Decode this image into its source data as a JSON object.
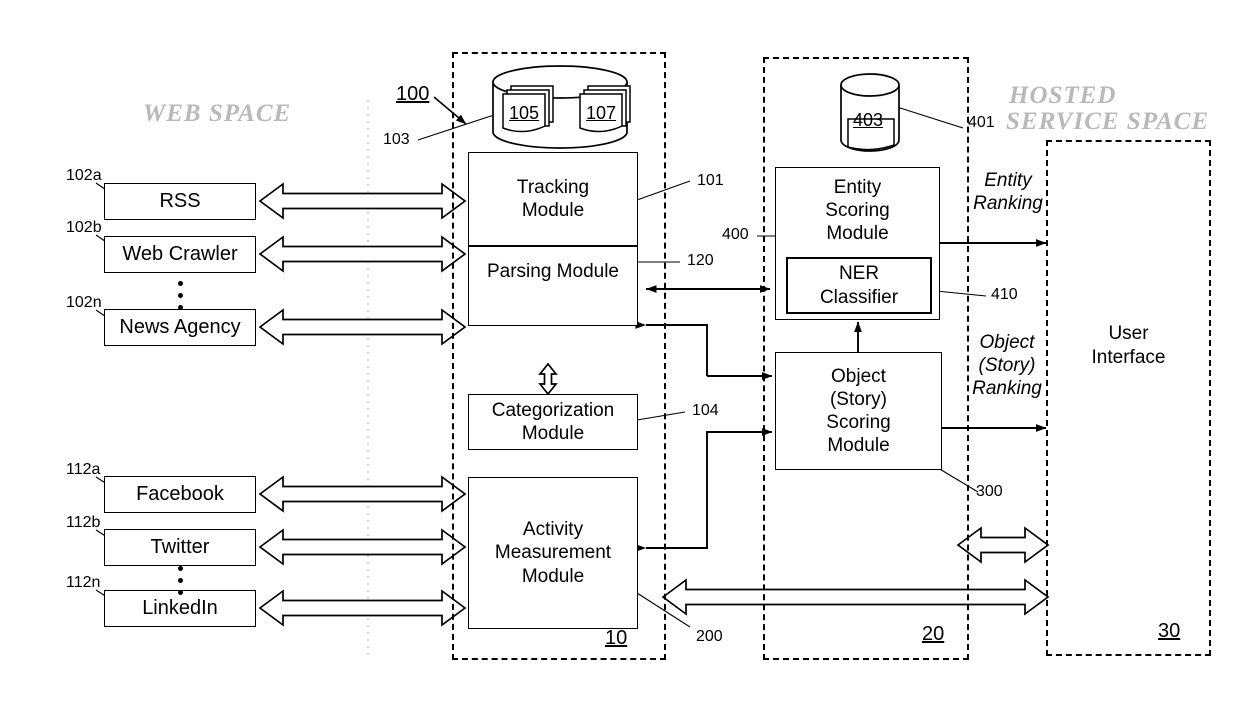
{
  "figure": {
    "spaces": {
      "web_space": "WEB SPACE",
      "hosted_service_space_line1": "HOSTED",
      "hosted_service_space_line2": "SERVICE SPACE"
    },
    "web_sources": [
      {
        "label": "RSS",
        "ref": "102a"
      },
      {
        "label": "Web Crawler",
        "ref": "102b"
      },
      {
        "label": "News Agency",
        "ref": "102n"
      }
    ],
    "social_sources": [
      {
        "label": "Facebook",
        "ref": "112a"
      },
      {
        "label": "Twitter",
        "ref": "112b"
      },
      {
        "label": "LinkedIn",
        "ref": "112n"
      }
    ],
    "modules": {
      "tracking": {
        "line1": "Tracking",
        "line2": "Module",
        "ref": "101"
      },
      "parsing": {
        "label": "Parsing Module",
        "ref": "120"
      },
      "categorization": {
        "line1": "Categorization",
        "line2": "Module",
        "ref": "104"
      },
      "activity": {
        "line1": "Activity",
        "line2": "Measurement",
        "line3": "Module",
        "ref": "200"
      },
      "entity_scoring": {
        "line1": "Entity",
        "line2": "Scoring",
        "line3": "Module",
        "ref": "400"
      },
      "ner": {
        "line1": "NER",
        "line2": "Classifier",
        "ref": "410"
      },
      "object_scoring": {
        "line1": "Object",
        "line2": "(Story)",
        "line3": "Scoring",
        "line4": "Module",
        "ref": "300"
      },
      "user_interface": {
        "line1": "User",
        "line2": "Interface"
      }
    },
    "datastores": {
      "content_store": {
        "ref": "103",
        "doc_a": "105",
        "doc_b": "107"
      },
      "entity_store": {
        "ref": "401",
        "label": "403"
      }
    },
    "flow_labels": {
      "entity_ranking_line1": "Entity",
      "entity_ranking_line2": "Ranking",
      "object_ranking_line1": "Object",
      "object_ranking_line2": "(Story)",
      "object_ranking_line3": "Ranking"
    },
    "system_refs": {
      "system": "100",
      "collection_subsystem": "10",
      "scoring_subsystem": "20",
      "ui_subsystem": "30"
    },
    "colors": {
      "line": "#000000",
      "space_title": "#b9b9b9",
      "background": "#ffffff"
    }
  }
}
